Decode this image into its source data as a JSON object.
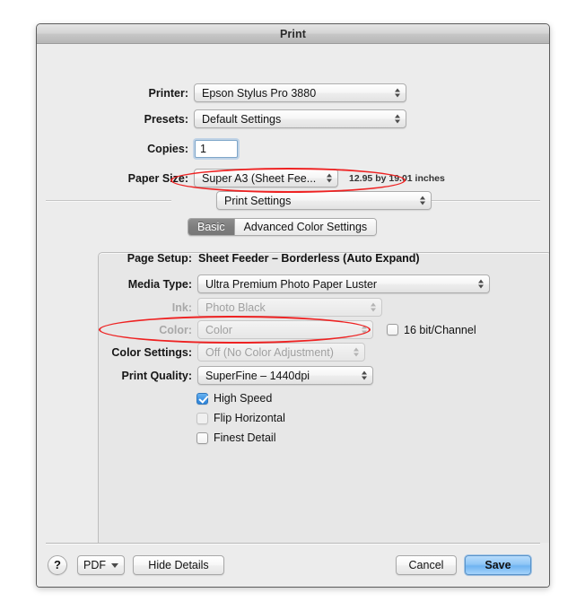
{
  "window": {
    "title": "Print"
  },
  "top_fields": {
    "printer_label": "Printer:",
    "printer_value": "Epson Stylus Pro 3880",
    "presets_label": "Presets:",
    "presets_value": "Default Settings",
    "copies_label": "Copies:",
    "copies_value": "1",
    "paper_size_label": "Paper Size:",
    "paper_size_value": "Super A3 (Sheet Fee...",
    "paper_size_note": "12.95 by 19.01 inches"
  },
  "pane_selector": {
    "value": "Print Settings"
  },
  "tabs": [
    {
      "label": "Basic",
      "active": true
    },
    {
      "label": "Advanced Color Settings",
      "active": false
    }
  ],
  "print_settings": {
    "page_setup_label": "Page Setup:",
    "page_setup_value": "Sheet Feeder – Borderless (Auto Expand)",
    "media_type_label": "Media Type:",
    "media_type_value": "Ultra Premium Photo Paper Luster",
    "ink_label": "Ink:",
    "ink_value": "Photo Black",
    "color_label": "Color:",
    "color_value": "Color",
    "sixteen_bit_label": "16 bit/Channel",
    "sixteen_bit_checked": false,
    "color_settings_label": "Color Settings:",
    "color_settings_value": "Off (No Color Adjustment)",
    "print_quality_label": "Print Quality:",
    "print_quality_value": "SuperFine – 1440dpi",
    "checkboxes": [
      {
        "label": "High Speed",
        "checked": true,
        "enabled": true
      },
      {
        "label": "Flip Horizontal",
        "checked": false,
        "enabled": false
      },
      {
        "label": "Finest Detail",
        "checked": false,
        "enabled": true
      }
    ]
  },
  "bottom_bar": {
    "help_label": "?",
    "pdf_label": "PDF",
    "hide_details_label": "Hide Details",
    "cancel_label": "Cancel",
    "save_label": "Save"
  },
  "annotations": {
    "accent_color": "#ee2222",
    "highlighted": [
      "Print Settings",
      "Color Settings: Off (No Color Adjustment)"
    ]
  }
}
